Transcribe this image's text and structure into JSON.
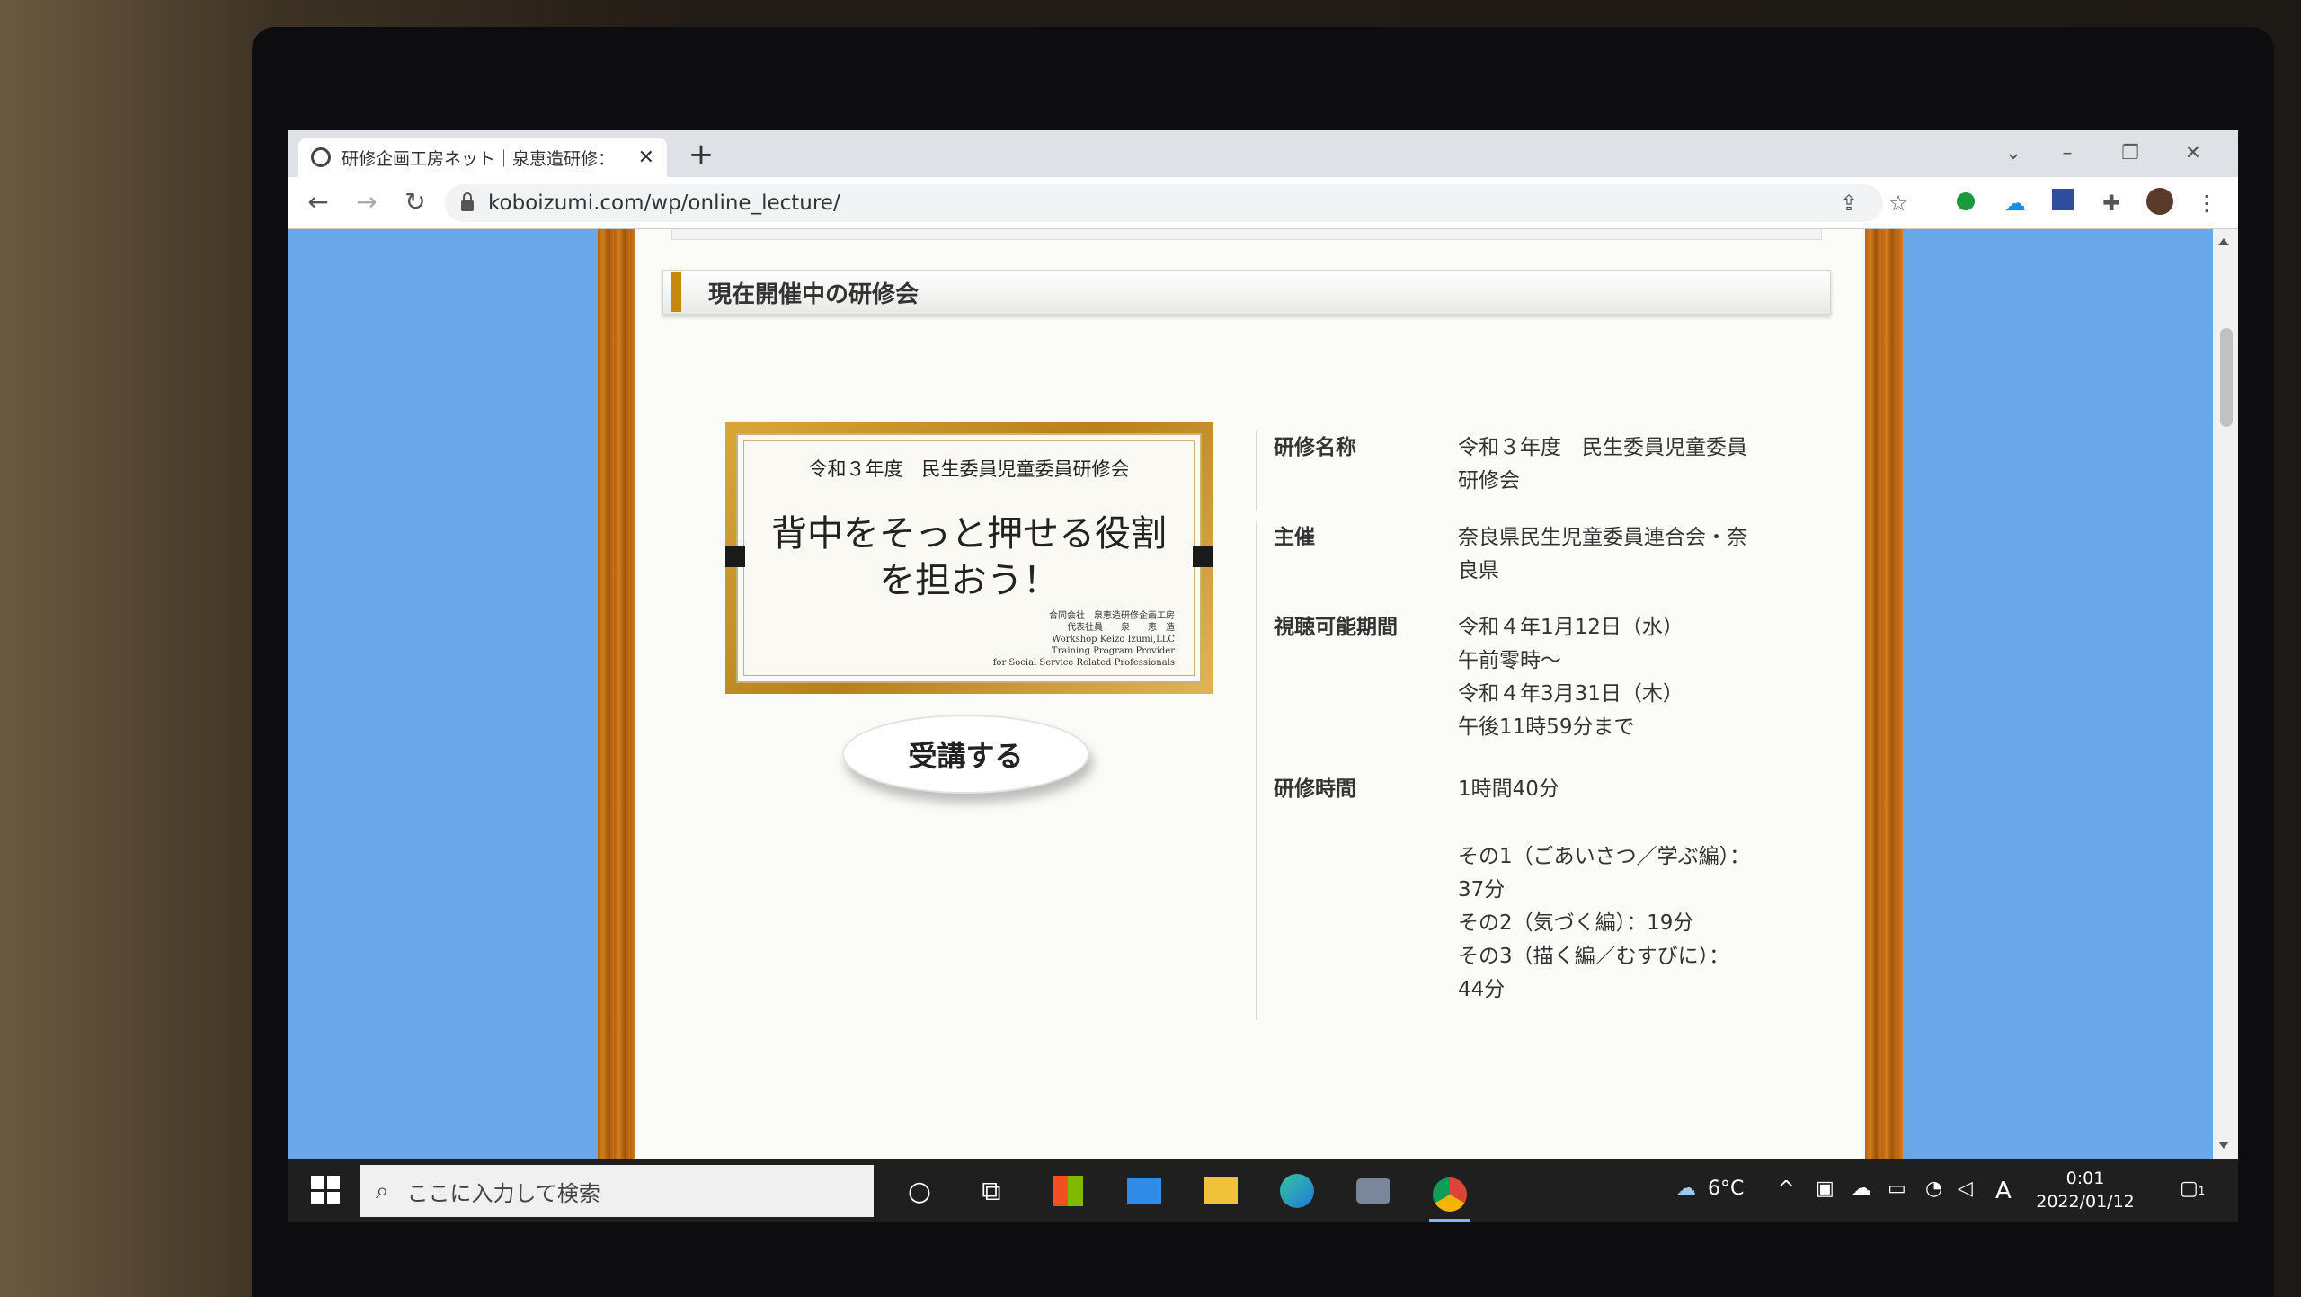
{
  "browser": {
    "tab_title": "研修企画工房ネット｜泉恵造研修：",
    "url": "koboizumi.com/wp/online_lecture/"
  },
  "page": {
    "section_title": "現在開催中の研修会",
    "banner": {
      "subtitle": "令和３年度　民生委員児童委員研修会",
      "main_line1": "背中をそっと押せる役割",
      "main_line2": "を担おう！",
      "credit_line1": "合同会社　泉恵造研修企画工房",
      "credit_line2": "代表社員　　泉　　恵　造",
      "credit_line3": "Workshop Keizo Izumi,LLC",
      "credit_line4": "Training Program Provider",
      "credit_line5": "for Social Service Related Professionals"
    },
    "cta_label": "受講する",
    "info": {
      "name_label": "研修名称",
      "name_value_1": "令和３年度　民生委員児童委員",
      "name_value_2": "研修会",
      "host_label": "主催",
      "host_value_1": "奈良県民生児童委員連合会・奈",
      "host_value_2": "良県",
      "period_label": "視聴可能期間",
      "period_1": "令和４年1月12日（水）",
      "period_2": "午前零時～",
      "period_3": "令和４年3月31日（木）",
      "period_4": "午後11時59分まで",
      "time_label": "研修時間",
      "time_total": "1時間40分",
      "part1_a": "その1（ごあいさつ／学ぶ編）：",
      "part1_b": "37分",
      "part2": "その2（気づく編）：19分",
      "part3_a": "その3（描く編／むすびに）：",
      "part3_b": "44分"
    }
  },
  "taskbar": {
    "search_placeholder": "ここに入力して検索",
    "weather": "6°C",
    "ime": "A",
    "time": "0:01",
    "date": "2022/01/12",
    "notification_count": "1"
  }
}
